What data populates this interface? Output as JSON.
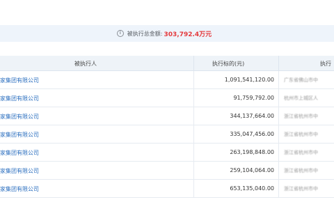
{
  "summary": {
    "label": "被执行总金额:",
    "value": "303,792.4万元",
    "icon": "info-icon"
  },
  "table": {
    "columns": [
      "被执行人",
      "执行标的(元)",
      "执行"
    ],
    "rows": [
      {
        "name": "家集团有限公司",
        "amount": "1,091,541,120.00",
        "court": "广东省佛山市中"
      },
      {
        "name": "家集团有限公司",
        "amount": "91,759,792.00",
        "court": "杭州市上城区人"
      },
      {
        "name": "家集团有限公司",
        "amount": "344,137,664.00",
        "court": "浙江省杭州市中"
      },
      {
        "name": "家集团有限公司",
        "amount": "335,047,456.00",
        "court": "浙江省杭州市中"
      },
      {
        "name": "家集团有限公司",
        "amount": "263,198,848.00",
        "court": "浙江省杭州市中"
      },
      {
        "name": "家集团有限公司",
        "amount": "259,104,064.00",
        "court": "浙江省杭州市中"
      },
      {
        "name": "家集团有限公司",
        "amount": "653,135,040.00",
        "court": "浙江省杭州市中"
      }
    ]
  }
}
